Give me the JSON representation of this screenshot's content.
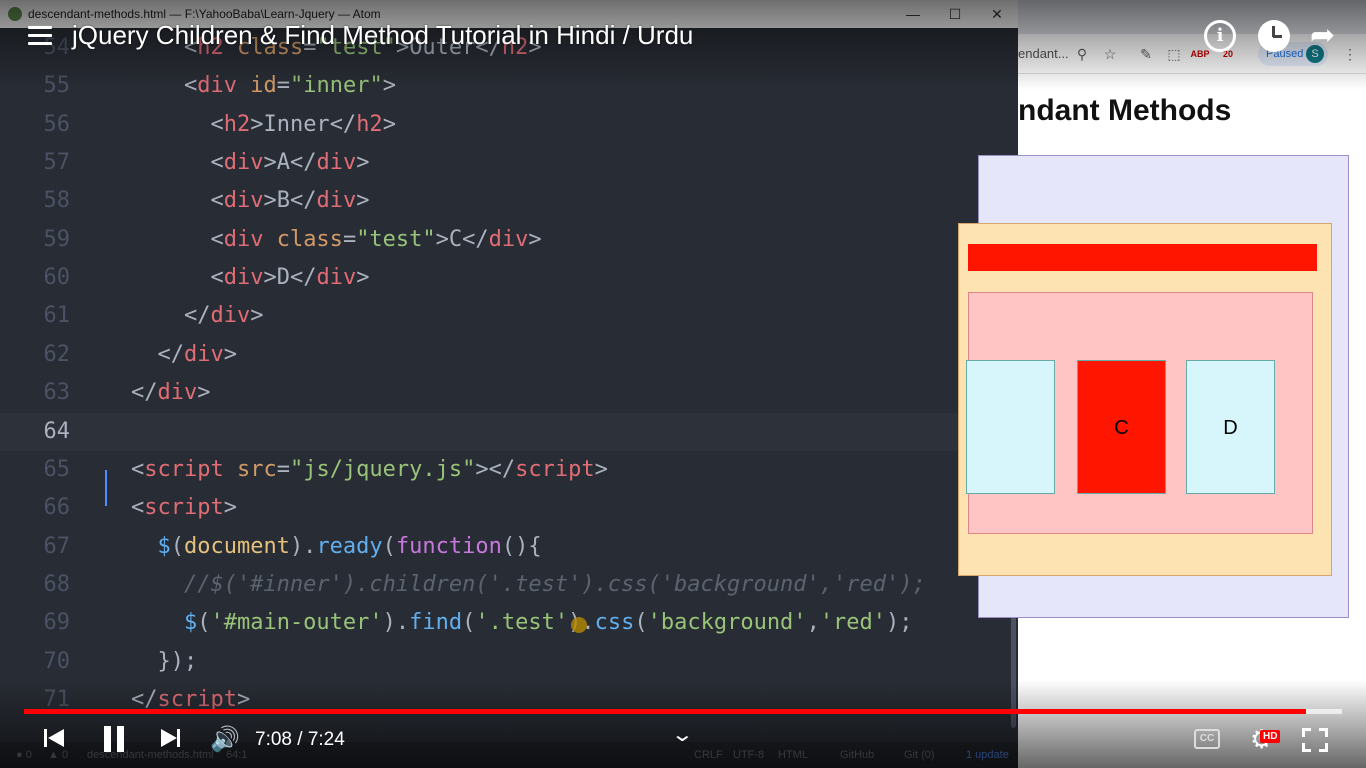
{
  "atom": {
    "window_title": "descendant-methods.html — F:\\YahooBaba\\Learn-Jquery — Atom",
    "minimize_glyph": "—",
    "maximize_glyph": "☐",
    "close_glyph": "✕",
    "status": {
      "errors": "0",
      "warnings": "0",
      "file": "descendant-methods.html",
      "position": "64:1",
      "crlf": "CRLF",
      "encoding": "UTF-8",
      "grammar": "HTML",
      "github": "GitHub",
      "git": "Git (0)",
      "updates": "1 update"
    },
    "code_lines": [
      {
        "n": "54",
        "tokens": [
          [
            "pun",
            "        <"
          ],
          [
            "tag",
            "h2"
          ],
          [
            "attr",
            " class"
          ],
          [
            "pun",
            "="
          ],
          [
            "str",
            "\"test\""
          ],
          [
            "pun",
            ">"
          ],
          [
            "txt",
            "Outer"
          ],
          [
            "pun",
            "</"
          ],
          [
            "tag",
            "h2"
          ],
          [
            "pun",
            ">"
          ]
        ]
      },
      {
        "n": "55",
        "tokens": [
          [
            "pun",
            "        <"
          ],
          [
            "tag",
            "div"
          ],
          [
            "attr",
            " id"
          ],
          [
            "pun",
            "="
          ],
          [
            "str",
            "\"inner\""
          ],
          [
            "pun",
            ">"
          ]
        ]
      },
      {
        "n": "56",
        "tokens": [
          [
            "pun",
            "          <"
          ],
          [
            "tag",
            "h2"
          ],
          [
            "pun",
            ">"
          ],
          [
            "txt",
            "Inner"
          ],
          [
            "pun",
            "</"
          ],
          [
            "tag",
            "h2"
          ],
          [
            "pun",
            ">"
          ]
        ]
      },
      {
        "n": "57",
        "tokens": [
          [
            "pun",
            "          <"
          ],
          [
            "tag",
            "div"
          ],
          [
            "pun",
            ">"
          ],
          [
            "txt",
            "A"
          ],
          [
            "pun",
            "</"
          ],
          [
            "tag",
            "div"
          ],
          [
            "pun",
            ">"
          ]
        ]
      },
      {
        "n": "58",
        "tokens": [
          [
            "pun",
            "          <"
          ],
          [
            "tag",
            "div"
          ],
          [
            "pun",
            ">"
          ],
          [
            "txt",
            "B"
          ],
          [
            "pun",
            "</"
          ],
          [
            "tag",
            "div"
          ],
          [
            "pun",
            ">"
          ]
        ]
      },
      {
        "n": "59",
        "tokens": [
          [
            "pun",
            "          <"
          ],
          [
            "tag",
            "div"
          ],
          [
            "attr",
            " class"
          ],
          [
            "pun",
            "="
          ],
          [
            "str",
            "\"test\""
          ],
          [
            "pun",
            ">"
          ],
          [
            "txt",
            "C"
          ],
          [
            "pun",
            "</"
          ],
          [
            "tag",
            "div"
          ],
          [
            "pun",
            ">"
          ]
        ]
      },
      {
        "n": "60",
        "tokens": [
          [
            "pun",
            "          <"
          ],
          [
            "tag",
            "div"
          ],
          [
            "pun",
            ">"
          ],
          [
            "txt",
            "D"
          ],
          [
            "pun",
            "</"
          ],
          [
            "tag",
            "div"
          ],
          [
            "pun",
            ">"
          ]
        ]
      },
      {
        "n": "61",
        "tokens": [
          [
            "pun",
            "        </"
          ],
          [
            "tag",
            "div"
          ],
          [
            "pun",
            ">"
          ]
        ]
      },
      {
        "n": "62",
        "tokens": [
          [
            "pun",
            "      </"
          ],
          [
            "tag",
            "div"
          ],
          [
            "pun",
            ">"
          ]
        ]
      },
      {
        "n": "63",
        "tokens": [
          [
            "pun",
            "    </"
          ],
          [
            "tag",
            "div"
          ],
          [
            "pun",
            ">"
          ]
        ]
      },
      {
        "n": "64",
        "tokens": [],
        "current": true
      },
      {
        "n": "65",
        "tokens": [
          [
            "pun",
            "    <"
          ],
          [
            "tag",
            "script"
          ],
          [
            "attr",
            " src"
          ],
          [
            "pun",
            "="
          ],
          [
            "str",
            "\"js/jquery.js\""
          ],
          [
            "pun",
            "></"
          ],
          [
            "tag",
            "script"
          ],
          [
            "pun",
            ">"
          ]
        ]
      },
      {
        "n": "66",
        "tokens": [
          [
            "pun",
            "    <"
          ],
          [
            "tag",
            "script"
          ],
          [
            "pun",
            ">"
          ]
        ]
      },
      {
        "n": "67",
        "tokens": [
          [
            "fn",
            "      $"
          ],
          [
            "pun",
            "("
          ],
          [
            "var",
            "document"
          ],
          [
            "pun",
            ")."
          ],
          [
            "fn",
            "ready"
          ],
          [
            "pun",
            "("
          ],
          [
            "kw",
            "function"
          ],
          [
            "pun",
            "(){"
          ]
        ]
      },
      {
        "n": "68",
        "tokens": [
          [
            "cmt",
            "        //$('#inner').children('.test').css('background','red');"
          ]
        ]
      },
      {
        "n": "69",
        "tokens": [
          [
            "fn",
            "        $"
          ],
          [
            "pun",
            "("
          ],
          [
            "str",
            "'#main-outer'"
          ],
          [
            "pun",
            ")."
          ],
          [
            "fn",
            "find"
          ],
          [
            "pun",
            "("
          ],
          [
            "str",
            "'.test'"
          ],
          [
            "pun",
            ")."
          ],
          [
            "fn",
            "css"
          ],
          [
            "pun",
            "("
          ],
          [
            "str",
            "'background'"
          ],
          [
            "pun",
            ","
          ],
          [
            "str",
            "'red'"
          ],
          [
            "pun",
            ");"
          ]
        ]
      },
      {
        "n": "70",
        "tokens": [
          [
            "pun",
            "      });"
          ]
        ]
      },
      {
        "n": "71",
        "tokens": [
          [
            "pun",
            "    </"
          ],
          [
            "tag",
            "script"
          ],
          [
            "pun",
            ">"
          ]
        ]
      }
    ]
  },
  "browser": {
    "address_fragment": "endant...",
    "paused_label": "Paused",
    "avatar_letter": "S",
    "page_heading": "ndant Methods",
    "boxes": {
      "c": "C",
      "d": "D"
    },
    "extension_badges": [
      "ABP",
      "20"
    ]
  },
  "youtube": {
    "title": "jQuery Children & Find Method Tutorial in Hindi / Urdu",
    "info_glyph": "i",
    "time_current": "7:08",
    "time_total": "7:24",
    "time_display": "7:08 / 7:24",
    "progress_fraction": 0.9725,
    "cc_label": "CC",
    "hd_badge": "HD",
    "share_glyph": "➦",
    "volume_glyph": "🔊",
    "settings_glyph": "⚙",
    "chevron_glyph": "⌄"
  },
  "colors": {
    "progress_red": "#ff0000",
    "editor_bg": "#282c34",
    "highlight_red": "#ff1500"
  }
}
